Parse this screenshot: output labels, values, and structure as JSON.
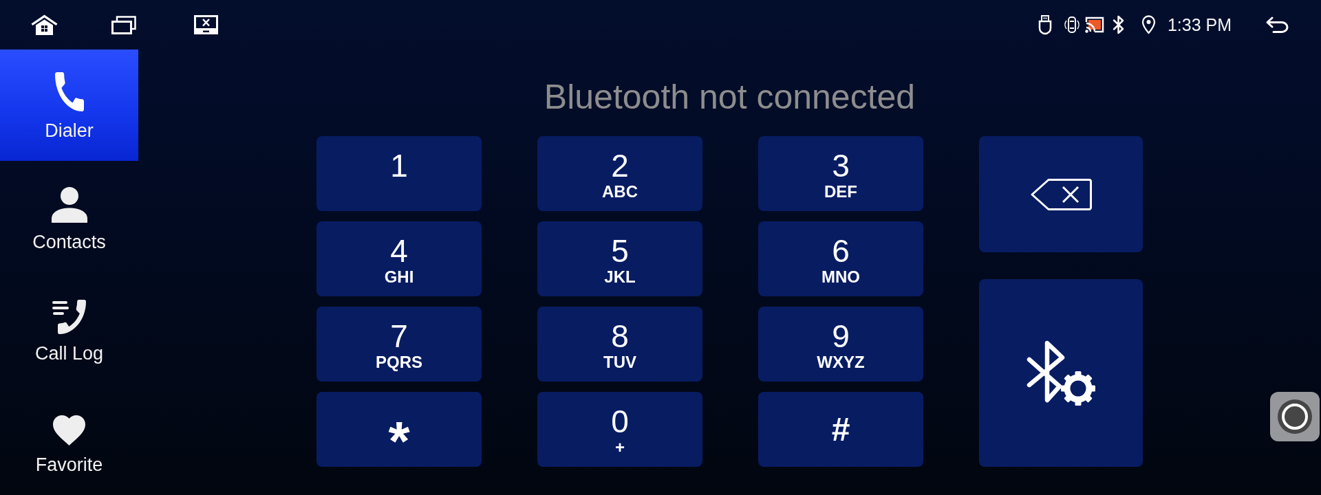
{
  "status_bar": {
    "time": "1:33 PM"
  },
  "sidebar": {
    "items": [
      {
        "label": "Dialer",
        "selected": true
      },
      {
        "label": "Contacts",
        "selected": false
      },
      {
        "label": "Call Log",
        "selected": false
      },
      {
        "label": "Favorite",
        "selected": false
      }
    ]
  },
  "dialer": {
    "message": "Bluetooth not connected",
    "keys": [
      {
        "kind": "digit",
        "label": "1"
      },
      {
        "kind": "digit",
        "label": "2",
        "letters": "ABC"
      },
      {
        "kind": "digit",
        "label": "3",
        "letters": "DEF"
      },
      {
        "kind": "digit",
        "label": "4",
        "letters": "GHI"
      },
      {
        "kind": "digit",
        "label": "5",
        "letters": "JKL"
      },
      {
        "kind": "digit",
        "label": "6",
        "letters": "MNO"
      },
      {
        "kind": "digit",
        "label": "7",
        "letters": "PQRS"
      },
      {
        "kind": "digit",
        "label": "8",
        "letters": "TUV"
      },
      {
        "kind": "digit",
        "label": "9",
        "letters": "WXYZ"
      },
      {
        "kind": "star",
        "label": "*"
      },
      {
        "kind": "digit",
        "label": "0",
        "letters": "+"
      },
      {
        "kind": "symbol",
        "label": "#"
      }
    ]
  }
}
